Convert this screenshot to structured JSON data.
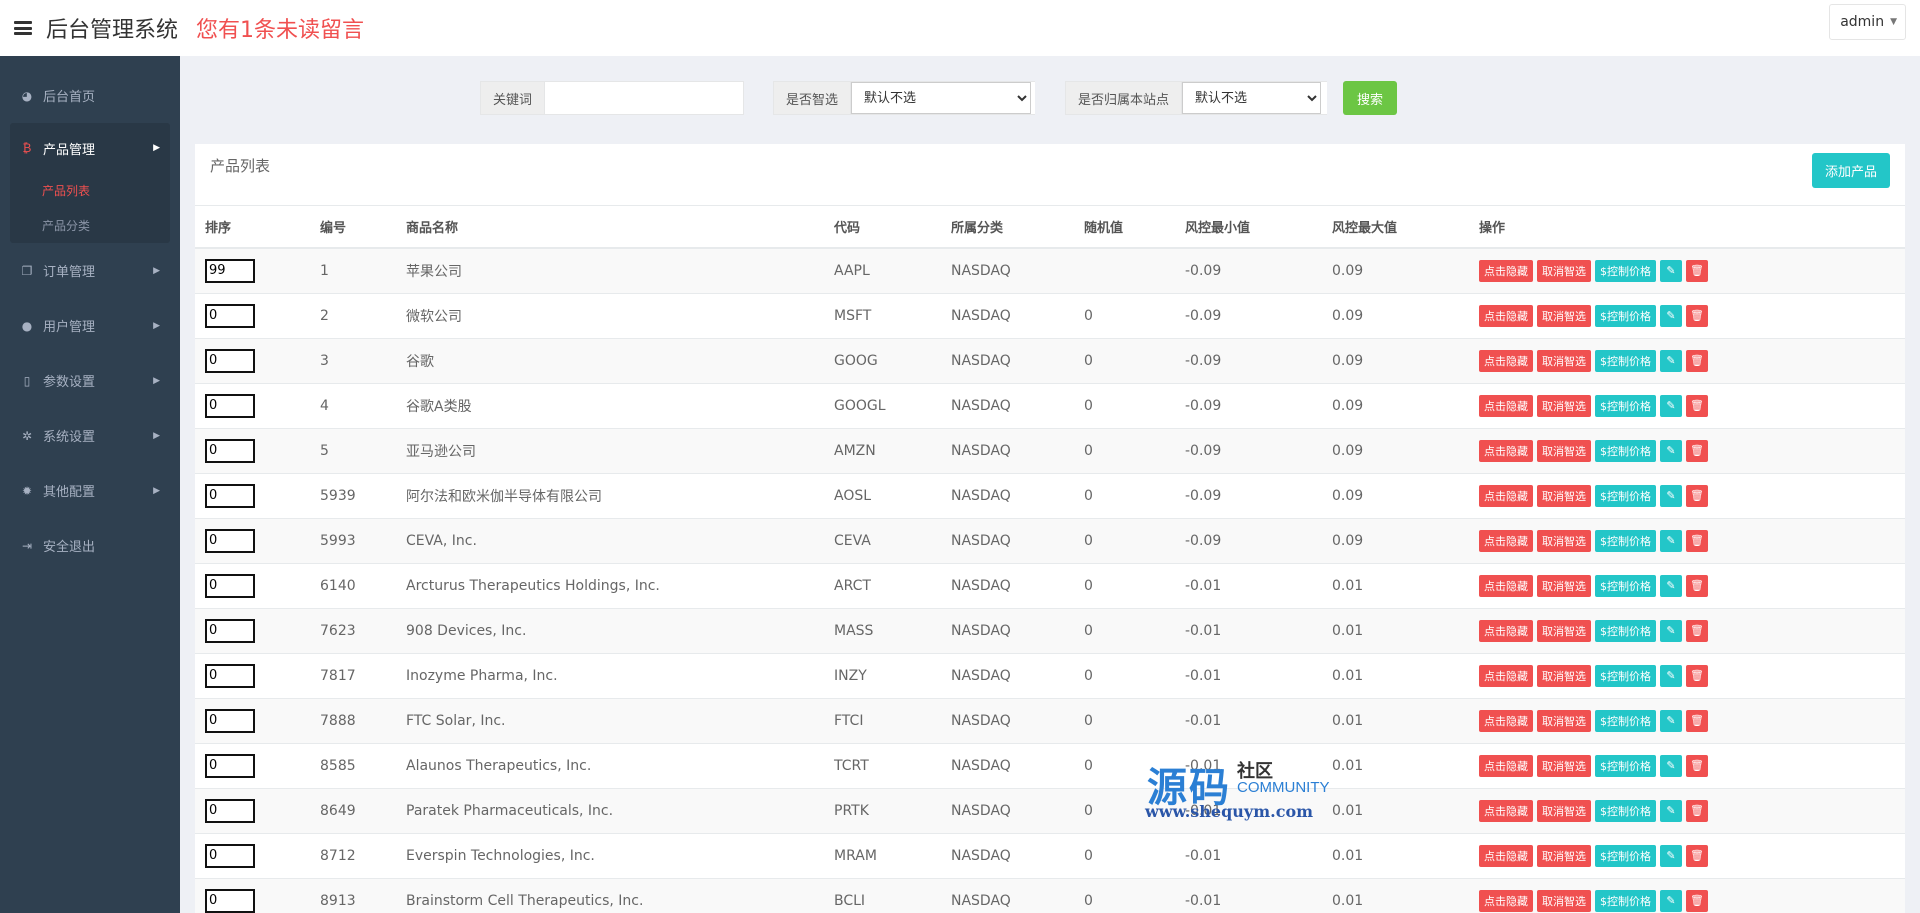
{
  "header": {
    "app_title": "后台管理系统",
    "notice": "您有1条未读留言",
    "user": "admin"
  },
  "sidebar": {
    "items": [
      {
        "label": "后台首页",
        "icon": "dashboard-icon"
      },
      {
        "label": "产品管理",
        "icon": "bitcoin-icon",
        "expanded": true,
        "children": [
          "产品列表",
          "产品分类"
        ],
        "active_child": "产品列表"
      },
      {
        "label": "订单管理",
        "icon": "copy-icon"
      },
      {
        "label": "用户管理",
        "icon": "user-icon"
      },
      {
        "label": "参数设置",
        "icon": "file-icon"
      },
      {
        "label": "系统设置",
        "icon": "cogs-icon"
      },
      {
        "label": "其他配置",
        "icon": "gear-icon"
      },
      {
        "label": "安全退出",
        "icon": "sign-out-icon"
      }
    ]
  },
  "search": {
    "keyword_label": "关键词",
    "keyword_value": "",
    "smart_label": "是否智选",
    "smart_selected": "默认不选",
    "site_label": "是否归属本站点",
    "site_selected": "默认不选",
    "search_button": "搜索"
  },
  "panel": {
    "title": "产品列表",
    "add_button": "添加产品"
  },
  "table": {
    "headers": [
      "排序",
      "编号",
      "商品名称",
      "代码",
      "所属分类",
      "随机值",
      "风控最小值",
      "风控最大值",
      "操作"
    ],
    "actions": {
      "hide": "点击隐藏",
      "unselect": "取消智选",
      "control": "$控制价格"
    },
    "rows": [
      {
        "sort": "99",
        "id": "1",
        "name": "苹果公司",
        "code": "AAPL",
        "category": "NASDAQ",
        "random": "",
        "min": "-0.09",
        "max": "0.09"
      },
      {
        "sort": "0",
        "id": "2",
        "name": "微软公司",
        "code": "MSFT",
        "category": "NASDAQ",
        "random": "0",
        "min": "-0.09",
        "max": "0.09"
      },
      {
        "sort": "0",
        "id": "3",
        "name": "谷歌",
        "code": "GOOG",
        "category": "NASDAQ",
        "random": "0",
        "min": "-0.09",
        "max": "0.09"
      },
      {
        "sort": "0",
        "id": "4",
        "name": "谷歌A类股",
        "code": "GOOGL",
        "category": "NASDAQ",
        "random": "0",
        "min": "-0.09",
        "max": "0.09"
      },
      {
        "sort": "0",
        "id": "5",
        "name": "亚马逊公司",
        "code": "AMZN",
        "category": "NASDAQ",
        "random": "0",
        "min": "-0.09",
        "max": "0.09"
      },
      {
        "sort": "0",
        "id": "5939",
        "name": "阿尔法和欧米伽半导体有限公司",
        "code": "AOSL",
        "category": "NASDAQ",
        "random": "0",
        "min": "-0.09",
        "max": "0.09"
      },
      {
        "sort": "0",
        "id": "5993",
        "name": "CEVA, Inc.",
        "code": "CEVA",
        "category": "NASDAQ",
        "random": "0",
        "min": "-0.09",
        "max": "0.09"
      },
      {
        "sort": "0",
        "id": "6140",
        "name": "Arcturus Therapeutics Holdings, Inc.",
        "code": "ARCT",
        "category": "NASDAQ",
        "random": "0",
        "min": "-0.01",
        "max": "0.01"
      },
      {
        "sort": "0",
        "id": "7623",
        "name": "908 Devices, Inc.",
        "code": "MASS",
        "category": "NASDAQ",
        "random": "0",
        "min": "-0.01",
        "max": "0.01"
      },
      {
        "sort": "0",
        "id": "7817",
        "name": "Inozyme Pharma, Inc.",
        "code": "INZY",
        "category": "NASDAQ",
        "random": "0",
        "min": "-0.01",
        "max": "0.01"
      },
      {
        "sort": "0",
        "id": "7888",
        "name": "FTC Solar, Inc.",
        "code": "FTCI",
        "category": "NASDAQ",
        "random": "0",
        "min": "-0.01",
        "max": "0.01"
      },
      {
        "sort": "0",
        "id": "8585",
        "name": "Alaunos Therapeutics, Inc.",
        "code": "TCRT",
        "category": "NASDAQ",
        "random": "0",
        "min": "-0.01",
        "max": "0.01"
      },
      {
        "sort": "0",
        "id": "8649",
        "name": "Paratek Pharmaceuticals, Inc.",
        "code": "PRTK",
        "category": "NASDAQ",
        "random": "0",
        "min": "-0.01",
        "max": "0.01"
      },
      {
        "sort": "0",
        "id": "8712",
        "name": "Everspin Technologies, Inc.",
        "code": "MRAM",
        "category": "NASDAQ",
        "random": "0",
        "min": "-0.01",
        "max": "0.01"
      },
      {
        "sort": "0",
        "id": "8913",
        "name": "Brainstorm Cell Therapeutics, Inc.",
        "code": "BCLI",
        "category": "NASDAQ",
        "random": "0",
        "min": "-0.01",
        "max": "0.01"
      }
    ]
  },
  "watermark": {
    "big": "源码",
    "small": "社区",
    "com": "COMMUNITY",
    "url": "www.shequym.com"
  }
}
